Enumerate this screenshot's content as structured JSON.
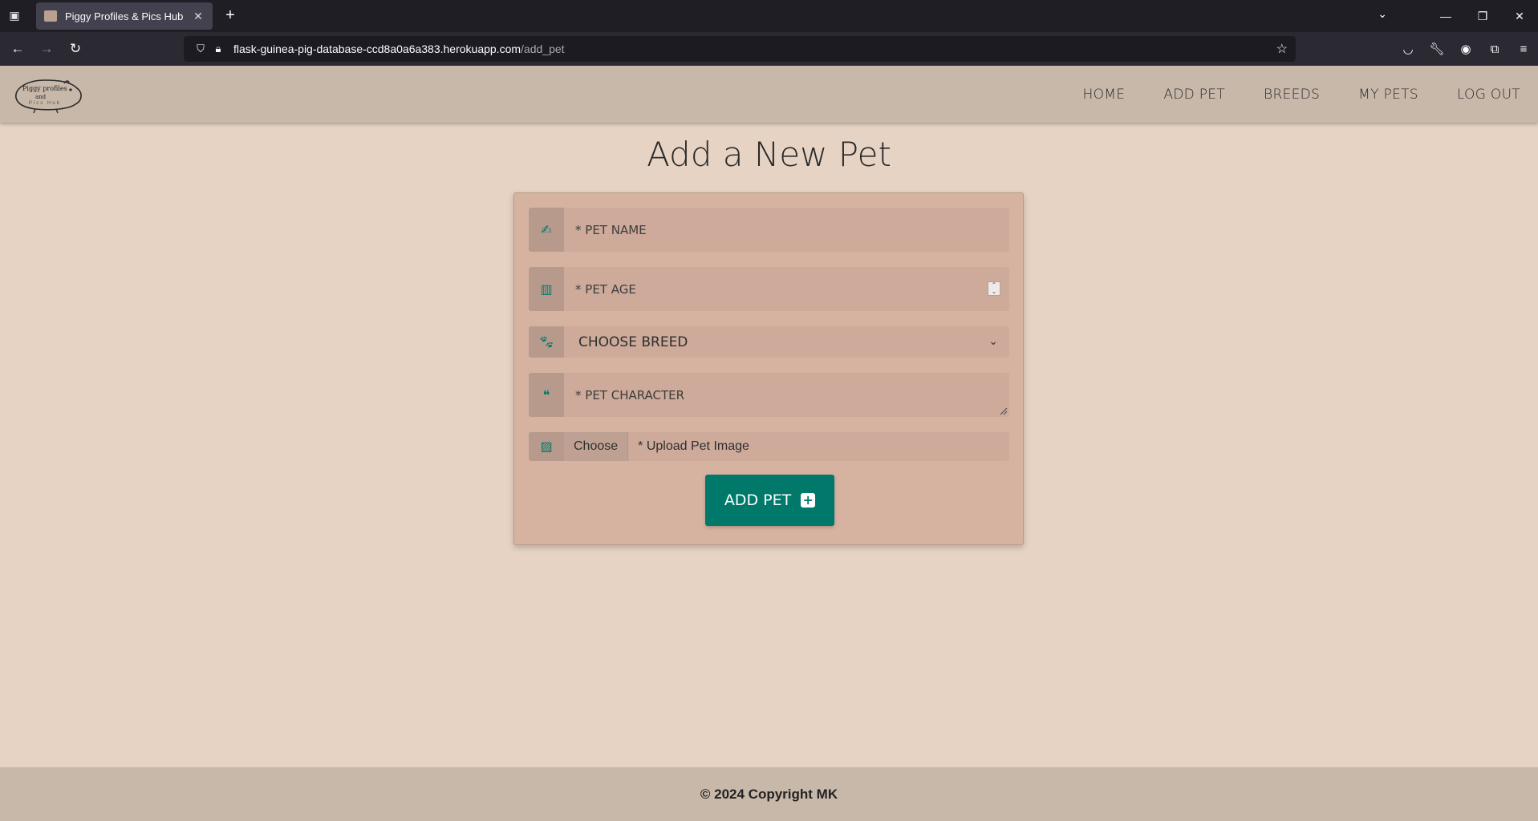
{
  "browser": {
    "tab_title": "Piggy Profiles & Pics Hub",
    "url_host": "flask-guinea-pig-database-ccd8a0a6a383.herokuapp.com",
    "url_path": "/add_pet"
  },
  "header": {
    "logo_text_line1": "Piggy profiles",
    "logo_text_line2": "and",
    "logo_text_line3": "Pics Hub",
    "nav": [
      {
        "label": "HOME"
      },
      {
        "label": "ADD PET"
      },
      {
        "label": "BREEDS"
      },
      {
        "label": "MY PETS"
      },
      {
        "label": "LOG OUT"
      }
    ]
  },
  "main": {
    "title": "Add a New Pet",
    "form": {
      "pet_name_placeholder": "* PET NAME",
      "pet_age_placeholder": "* PET AGE",
      "breed_selected": "CHOOSE BREED",
      "pet_character_placeholder": "* PET CHARACTER",
      "choose_label": "Choose",
      "upload_label": "* Upload Pet Image",
      "submit_label": "ADD PET"
    }
  },
  "footer": {
    "text": "© 2024 Copyright MK"
  },
  "colors": {
    "accent": "#00796b",
    "page_bg": "#e6d3c4",
    "header_bg": "#c8b8aa",
    "card_bg": "#d6b3a1"
  }
}
